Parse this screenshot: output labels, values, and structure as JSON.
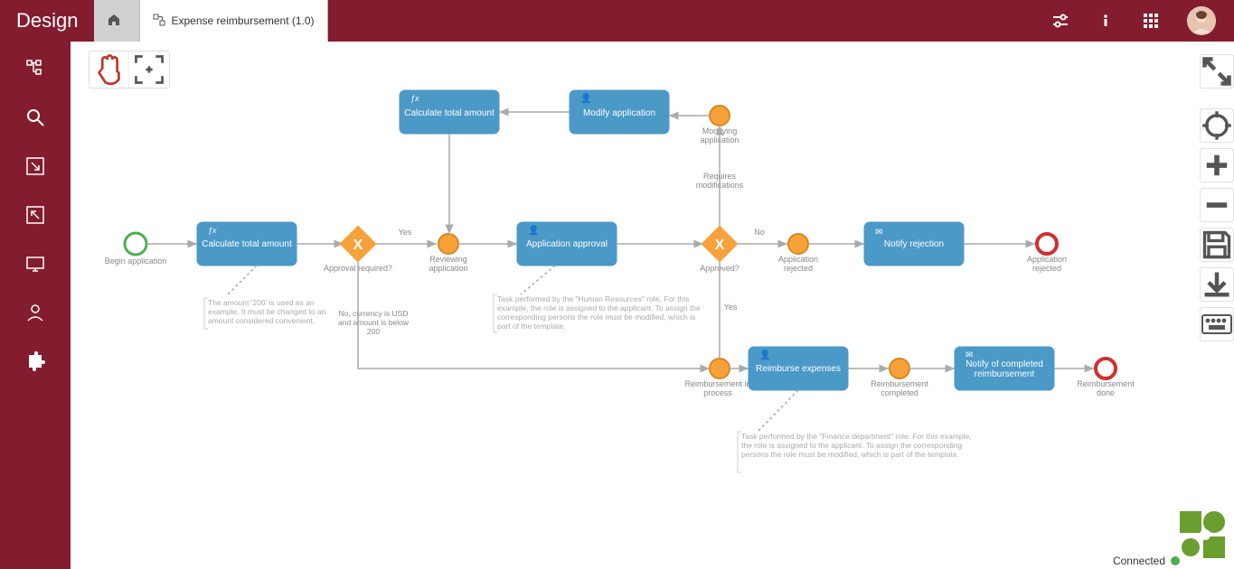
{
  "app_title": "Design",
  "tabs": {
    "home_icon": "home-icon",
    "current": "Expense reimbursement (1.0)"
  },
  "status": "Connected",
  "sidebar_icons": [
    "tree-icon",
    "search-icon",
    "arrow-down-right-box-icon",
    "arrow-up-left-box-icon",
    "screen-icon",
    "person-icon",
    "puzzle-icon"
  ],
  "header_icons": [
    "sliders-icon",
    "info-icon",
    "apps-grid-icon",
    "avatar"
  ],
  "right_tools": [
    "fullscreen-icon",
    "target-icon",
    "plus-icon",
    "minus-icon",
    "save-icon",
    "download-icon",
    "keyboard-icon"
  ],
  "toolbar": [
    "hand-icon",
    "fit-frame-icon"
  ],
  "nodes": {
    "start": "Begin application",
    "calc1": "Calculate total amount",
    "calc2": "Calculate total amount",
    "modify": "Modify application",
    "modifying": "Modifying application",
    "gateway1": "Approval required?",
    "reviewing": "Reviewing application",
    "approval": "Application approval",
    "gateway2": "Approved?",
    "rejected": "Application rejected",
    "notify_reject": "Notify rejection",
    "end_reject": "Application rejected",
    "reimb_inprocess": "Reimbursement in process",
    "reimburse": "Reimburse expenses",
    "reimb_done": "Reimbursement completed",
    "notify_complete": "Notify of completed reimbursement",
    "end_done": "Reimbursement done"
  },
  "edges": {
    "yes1": "Yes",
    "no1": "No, currency is USD and amount is below 200",
    "req_mod": "Requires modifications",
    "no2": "No",
    "yes2": "Yes"
  },
  "notes": {
    "n1": "The amount '200' is used as an example. It must be changed to an amount considered convenient.",
    "n2": "Task performed by the \"Human Resources\" role. For this example, the role is assigned to the applicant. To assign the corresponding persons the role must be modified, which is part of the template.",
    "n3": "Task performed by the \"Finance department\" role. For this example, the role is assigned to the applicant. To assign the corresponding persons the role must be modified, which is part of the template."
  }
}
